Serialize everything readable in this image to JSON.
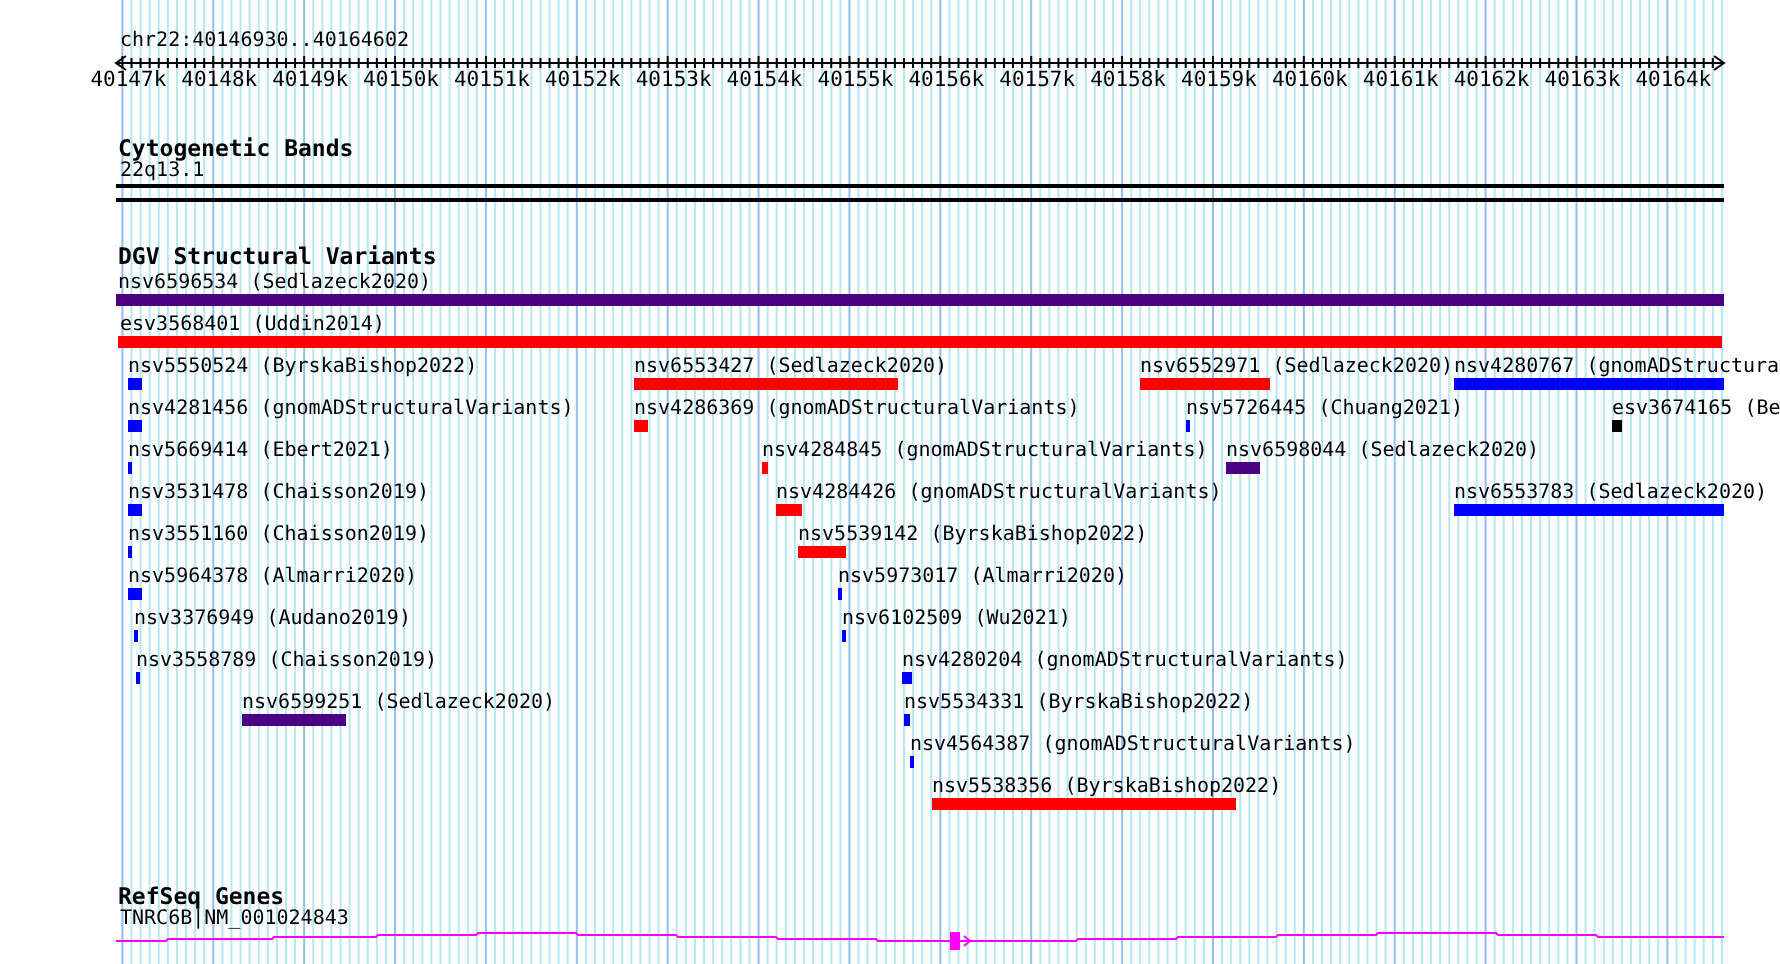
{
  "ruler": {
    "location": "chr22:40146930..40164602",
    "ticks": [
      "40147k",
      "40148k",
      "40149k",
      "40150k",
      "40151k",
      "40152k",
      "40153k",
      "40154k",
      "40155k",
      "40156k",
      "40157k",
      "40158k",
      "40159k",
      "40160k",
      "40161k",
      "40162k",
      "40163k",
      "40164k"
    ]
  },
  "tracks": [
    {
      "kind": "bands",
      "title": "Cytogenetic Bands",
      "features": [
        {
          "label": "22q13.1"
        }
      ]
    },
    {
      "kind": "variants",
      "title": "DGV Structural Variants",
      "rows": [
        [
          {
            "label": "nsv6596534 (Sedlazeck2020)",
            "color": "#4b0082"
          }
        ],
        [
          {
            "label": "esv3568401 (Uddin2014)",
            "color": "#ff0000"
          }
        ],
        [
          {
            "label": "nsv5550524 (ByrskaBishop2022)",
            "color": "#0000ff"
          },
          {
            "label": "nsv6553427 (Sedlazeck2020)",
            "color": "#ff0000"
          },
          {
            "label": "nsv6552971 (Sedlazeck2020)",
            "color": "#ff0000"
          },
          {
            "label": "nsv4280767 (gnomADStructura",
            "color": "#0000ff"
          }
        ],
        [
          {
            "label": "nsv4281456 (gnomADStructuralVariants)",
            "color": "#0000ff"
          },
          {
            "label": "nsv4286369 (gnomADStructuralVariants)",
            "color": "#ff0000"
          },
          {
            "label": "nsv5726445 (Chuang2021)",
            "color": "#0000ff"
          },
          {
            "label": "esv3674165 (Be",
            "color": "#000000"
          }
        ],
        [
          {
            "label": "nsv5669414 (Ebert2021)",
            "color": "#0000ff"
          },
          {
            "label": "nsv4284845 (gnomADStructuralVariants)",
            "color": "#ff0000"
          },
          {
            "label": "nsv6598044 (Sedlazeck2020)",
            "color": "#4b0082"
          }
        ],
        [
          {
            "label": "nsv3531478 (Chaisson2019)",
            "color": "#0000ff"
          },
          {
            "label": "nsv4284426 (gnomADStructuralVariants)",
            "color": "#ff0000"
          },
          {
            "label": "nsv6553783 (Sedlazeck2020)",
            "color": "#0000ff"
          }
        ],
        [
          {
            "label": "nsv3551160 (Chaisson2019)",
            "color": "#0000ff"
          },
          {
            "label": "nsv5539142 (ByrskaBishop2022)",
            "color": "#ff0000"
          }
        ],
        [
          {
            "label": "nsv5964378 (Almarri2020)",
            "color": "#0000ff"
          },
          {
            "label": "nsv5973017 (Almarri2020)",
            "color": "#0000ff"
          }
        ],
        [
          {
            "label": "nsv3376949 (Audano2019)",
            "color": "#0000ff"
          },
          {
            "label": "nsv6102509 (Wu2021)",
            "color": "#0000ff"
          }
        ],
        [
          {
            "label": "nsv3558789 (Chaisson2019)",
            "color": "#0000ff"
          },
          {
            "label": "nsv4280204 (gnomADStructuralVariants)",
            "color": "#0000ff"
          }
        ],
        [
          {
            "label": "nsv6599251 (Sedlazeck2020)",
            "color": "#4b0082"
          },
          {
            "label": "nsv5534331 (ByrskaBishop2022)",
            "color": "#0000ff"
          }
        ],
        [
          {
            "label": "nsv4564387 (gnomADStructuralVariants)",
            "color": "#0000ff"
          }
        ],
        [
          {
            "label": "nsv5538356 (ByrskaBishop2022)",
            "color": "#ff0000"
          }
        ]
      ]
    },
    {
      "kind": "genes",
      "title": "RefSeq Genes",
      "features": [
        {
          "label": "TNRC6B|NM_001024843"
        }
      ]
    }
  ]
}
